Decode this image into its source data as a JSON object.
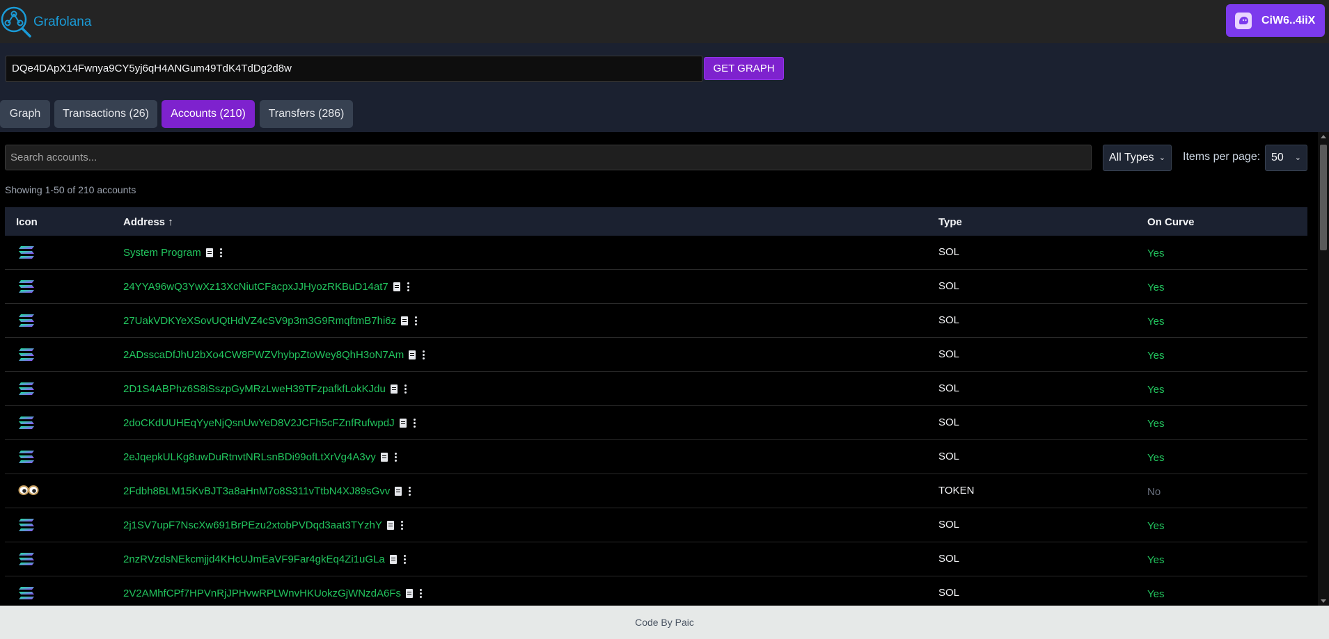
{
  "app": {
    "name": "Grafolana"
  },
  "wallet": {
    "label": "CiW6..4iiX"
  },
  "graph_search": {
    "value": "DQe4DApX14Fwnya9CY5yj6qH4ANGum49TdK4TdDg2d8w",
    "button": "GET GRAPH"
  },
  "tabs": [
    {
      "label": "Graph"
    },
    {
      "label": "Transactions (26)"
    },
    {
      "label": "Accounts (210)",
      "active": true
    },
    {
      "label": "Transfers (286)"
    }
  ],
  "accounts": {
    "search_placeholder": "Search accounts...",
    "type_filter": "All Types",
    "items_per_page_label": "Items per page:",
    "items_per_page": "50",
    "showing": "Showing 1-50 of 210 accounts",
    "columns": {
      "icon": "Icon",
      "address": "Address ↑",
      "type": "Type",
      "on_curve": "On Curve"
    },
    "rows": [
      {
        "icon": "solana-icon",
        "address": "System Program",
        "type": "SOL",
        "on_curve": "Yes"
      },
      {
        "icon": "solana-icon",
        "address": "24YYA96wQ3YwXz13XcNiutCFacpxJJHyozRKBuD14at7",
        "type": "SOL",
        "on_curve": "Yes"
      },
      {
        "icon": "solana-icon",
        "address": "27UakVDKYeXSovUQtHdVZ4cSV9p3m3G9RmqftmB7hi6z",
        "type": "SOL",
        "on_curve": "Yes"
      },
      {
        "icon": "solana-icon",
        "address": "2ADsscaDfJhU2bXo4CW8PWZVhybpZtoWey8QhH3oN7Am",
        "type": "SOL",
        "on_curve": "Yes"
      },
      {
        "icon": "solana-icon",
        "address": "2D1S4ABPhz6S8iSszpGyMRzLweH39TFzpafkfLokKJdu",
        "type": "SOL",
        "on_curve": "Yes"
      },
      {
        "icon": "solana-icon",
        "address": "2doCKdUUHEqYyeNjQsnUwYeD8V2JCFh5cFZnfRufwpdJ",
        "type": "SOL",
        "on_curve": "Yes"
      },
      {
        "icon": "solana-icon",
        "address": "2eJqepkULKg8uwDuRtnvtNRLsnBDi99ofLtXrVg4A3vy",
        "type": "SOL",
        "on_curve": "Yes"
      },
      {
        "icon": "token-eyes-icon",
        "address": "2Fdbh8BLM15KvBJT3a8aHnM7o8S311vTtbN4XJ89sGvv",
        "type": "TOKEN",
        "on_curve": "No"
      },
      {
        "icon": "solana-icon",
        "address": "2j1SV7upF7NscXw691BrPEzu2xtobPVDqd3aat3TYzhY",
        "type": "SOL",
        "on_curve": "Yes"
      },
      {
        "icon": "solana-icon",
        "address": "2nzRVzdsNEkcmjjd4KHcUJmEaVF9Far4gkEq4Zi1uGLa",
        "type": "SOL",
        "on_curve": "Yes"
      },
      {
        "icon": "solana-icon",
        "address": "2V2AMhfCPf7HPVnRjJPHvwRPLWnvHKUokzGjWNzdA6Fs",
        "type": "SOL",
        "on_curve": "Yes"
      }
    ]
  },
  "footer": {
    "text": "Code By Paic"
  },
  "colors": {
    "accent": "#7e22ce",
    "link": "#22c55e",
    "header_bg": "#242424",
    "toolbar_bg": "#1b2130"
  }
}
